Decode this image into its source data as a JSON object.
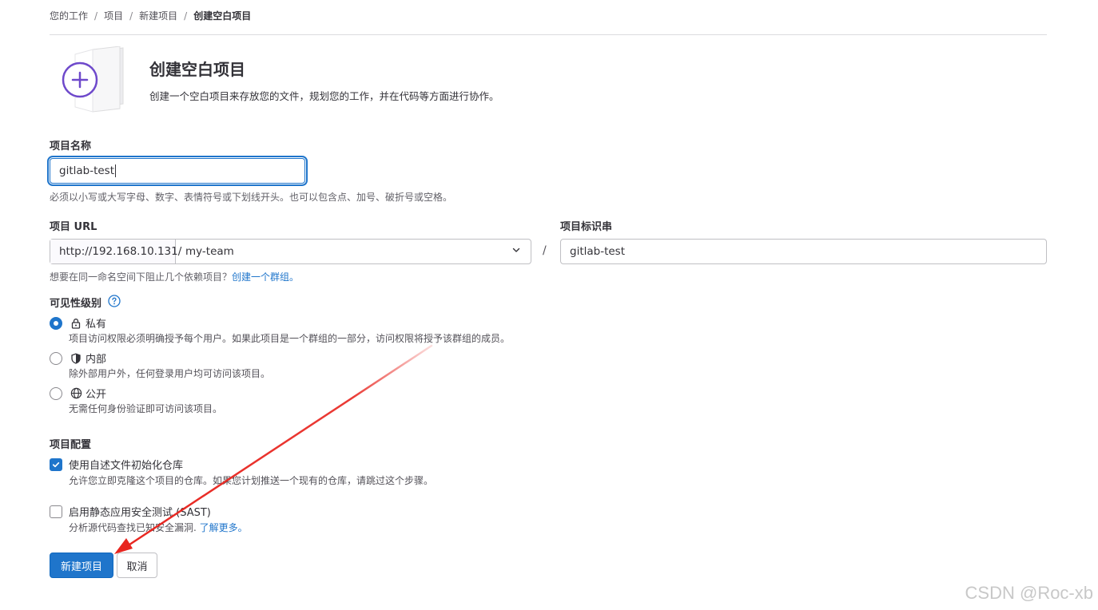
{
  "breadcrumb": {
    "items": [
      "您的工作",
      "项目",
      "新建项目",
      "创建空白项目"
    ]
  },
  "header": {
    "title": "创建空白项目",
    "description": "创建一个空白项目来存放您的文件，规划您的工作，并在代码等方面进行协作。"
  },
  "project_name": {
    "label": "项目名称",
    "value": "gitlab-test",
    "help": "必须以小写或大写字母、数字、表情符号或下划线开头。也可以包含点、加号、破折号或空格。"
  },
  "project_url": {
    "label": "项目 URL",
    "prefix": "http://192.168.10.131/",
    "namespace": "my-team",
    "separator": "/",
    "help_text": "想要在同一命名空间下阻止几个依赖项目？",
    "help_link": "创建一个群组。"
  },
  "project_slug": {
    "label": "项目标识串",
    "value": "gitlab-test"
  },
  "visibility": {
    "label": "可见性级别",
    "options": [
      {
        "label": "私有",
        "description": "项目访问权限必须明确授予每个用户。如果此项目是一个群组的一部分，访问权限将授予该群组的成员。",
        "checked": true,
        "icon": "lock-icon"
      },
      {
        "label": "内部",
        "description": "除外部用户外，任何登录用户均可访问该项目。",
        "checked": false,
        "icon": "shield-icon"
      },
      {
        "label": "公开",
        "description": "无需任何身份验证即可访问该项目。",
        "checked": false,
        "icon": "globe-icon"
      }
    ]
  },
  "config": {
    "label": "项目配置",
    "readme": {
      "label": "使用自述文件初始化仓库",
      "description": "允许您立即克隆这个项目的仓库。如果您计划推送一个现有的仓库，请跳过这个步骤。",
      "checked": true
    },
    "sast": {
      "label": "启用静态应用安全测试 (SAST)",
      "description": "分析源代码查找已知安全漏洞.",
      "link": "了解更多。",
      "checked": false
    }
  },
  "actions": {
    "create": "新建项目",
    "cancel": "取消"
  },
  "watermark": "CSDN @Roc-xb",
  "colors": {
    "primary": "#1f75cb",
    "annotation_arrow": "#e8251f",
    "illustration_accent": "#6e49cb"
  }
}
